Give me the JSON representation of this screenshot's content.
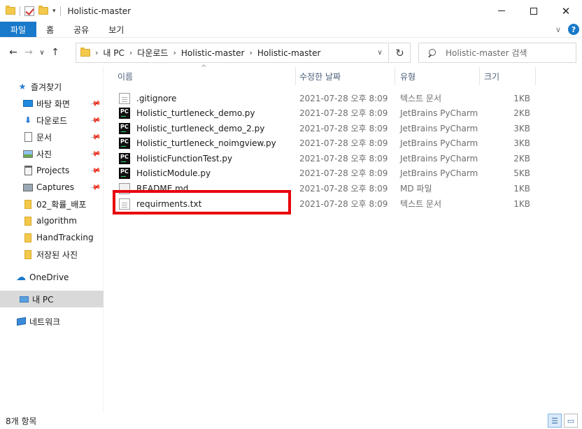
{
  "window": {
    "title": "Holistic-master"
  },
  "ribbon": {
    "tabs": [
      "파일",
      "홈",
      "공유",
      "보기"
    ]
  },
  "address": {
    "crumbs": [
      "내 PC",
      "다운로드",
      "Holistic-master",
      "Holistic-master"
    ],
    "search_placeholder": "Holistic-master 검색"
  },
  "sidebar": {
    "items": [
      {
        "label": "즐겨찾기",
        "icon": "star-icon"
      },
      {
        "label": "바탕 화면",
        "icon": "desktop-icon",
        "pinned": true
      },
      {
        "label": "다운로드",
        "icon": "download-icon",
        "pinned": true
      },
      {
        "label": "문서",
        "icon": "document-icon",
        "pinned": true
      },
      {
        "label": "사진",
        "icon": "pictures-icon",
        "pinned": true
      },
      {
        "label": "Projects",
        "icon": "clipboard-icon",
        "pinned": true
      },
      {
        "label": "Captures",
        "icon": "captures-icon",
        "pinned": true
      },
      {
        "label": "02_확률_배포",
        "icon": "folder-icon"
      },
      {
        "label": "algorithm",
        "icon": "folder-icon"
      },
      {
        "label": "HandTracking",
        "icon": "folder-icon"
      },
      {
        "label": "저장된 사진",
        "icon": "folder-icon"
      },
      {
        "label": "OneDrive",
        "icon": "cloud-icon"
      },
      {
        "label": "내 PC",
        "icon": "computer-icon",
        "selected": true
      },
      {
        "label": "네트워크",
        "icon": "network-icon"
      }
    ]
  },
  "columns": {
    "name": "이름",
    "date": "수정한 날짜",
    "type": "유형",
    "size": "크기"
  },
  "files": [
    {
      "name": ".gitignore",
      "date": "2021-07-28 오후 8:09",
      "type": "텍스트 문서",
      "size": "1KB",
      "icon": "text-file-icon"
    },
    {
      "name": "Holistic_turtleneck_demo.py",
      "date": "2021-07-28 오후 8:09",
      "type": "JetBrains PyCharm",
      "size": "2KB",
      "icon": "pycharm-file-icon"
    },
    {
      "name": "Holistic_turtleneck_demo_2.py",
      "date": "2021-07-28 오후 8:09",
      "type": "JetBrains PyCharm",
      "size": "3KB",
      "icon": "pycharm-file-icon"
    },
    {
      "name": "Holistic_turtleneck_noimgview.py",
      "date": "2021-07-28 오후 8:09",
      "type": "JetBrains PyCharm",
      "size": "3KB",
      "icon": "pycharm-file-icon"
    },
    {
      "name": "HolisticFunctionTest.py",
      "date": "2021-07-28 오후 8:09",
      "type": "JetBrains PyCharm",
      "size": "2KB",
      "icon": "pycharm-file-icon"
    },
    {
      "name": "HolisticModule.py",
      "date": "2021-07-28 오후 8:09",
      "type": "JetBrains PyCharm",
      "size": "5KB",
      "icon": "pycharm-file-icon"
    },
    {
      "name": "README.md",
      "date": "2021-07-28 오후 8:09",
      "type": "MD 파일",
      "size": "1KB",
      "icon": "markdown-file-icon"
    },
    {
      "name": "requirments.txt",
      "date": "2021-07-28 오후 8:09",
      "type": "텍스트 문서",
      "size": "1KB",
      "icon": "text-file-icon",
      "highlighted": true
    }
  ],
  "status": {
    "item_count": "8개 항목"
  },
  "colors": {
    "accent": "#1979ca",
    "highlight_box": "#e8000b",
    "selected_bg": "#d9d9d9"
  }
}
